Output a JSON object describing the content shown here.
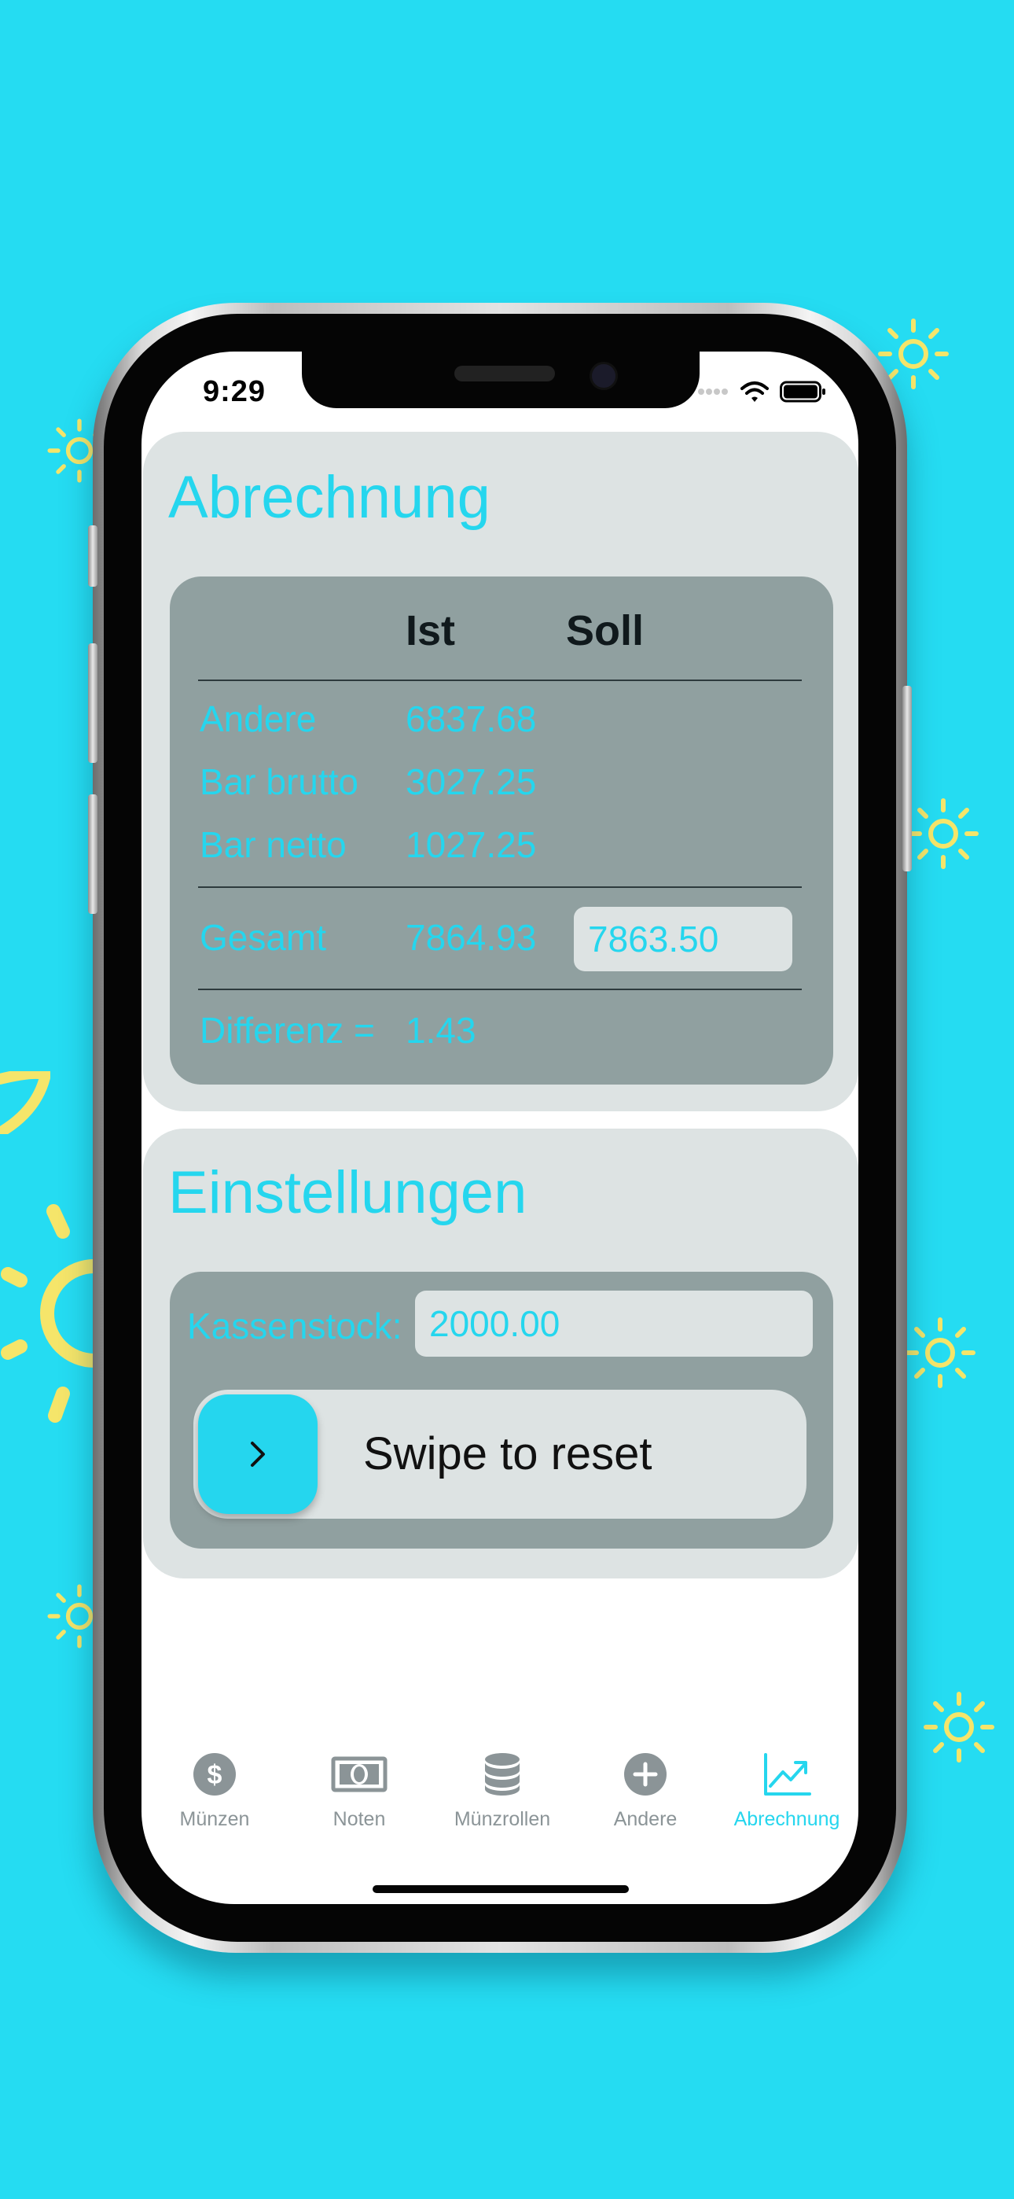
{
  "status_bar": {
    "time": "9:29"
  },
  "abrechnung": {
    "title": "Abrechnung",
    "headers": {
      "ist": "Ist",
      "soll": "Soll"
    },
    "rows": [
      {
        "label": "Andere",
        "ist": "6837.68"
      },
      {
        "label": "Bar brutto",
        "ist": "3027.25"
      },
      {
        "label": "Bar netto",
        "ist": "1027.25"
      }
    ],
    "gesamt": {
      "label": "Gesamt",
      "ist": "7864.93",
      "soll_value": "7863.50"
    },
    "differenz": {
      "label": "Differenz =",
      "value": "1.43"
    }
  },
  "einstellungen": {
    "title": "Einstellungen",
    "kassenstock_label": "Kassenstock:",
    "kassenstock_value": "2000.00",
    "swipe_label": "Swipe to reset"
  },
  "tabs": [
    {
      "label": "Münzen",
      "icon": "dollar-coin-icon",
      "active": false
    },
    {
      "label": "Noten",
      "icon": "banknote-icon",
      "active": false
    },
    {
      "label": "Münzrollen",
      "icon": "coin-roll-icon",
      "active": false
    },
    {
      "label": "Andere",
      "icon": "plus-circle-icon",
      "active": false
    },
    {
      "label": "Abrechnung",
      "icon": "chart-trend-icon",
      "active": true
    }
  ],
  "colors": {
    "accent": "#25d6ee",
    "background": "#25dcf2",
    "card": "#dde3e3",
    "panel": "#90a0a0",
    "inactive": "#8b9497"
  }
}
